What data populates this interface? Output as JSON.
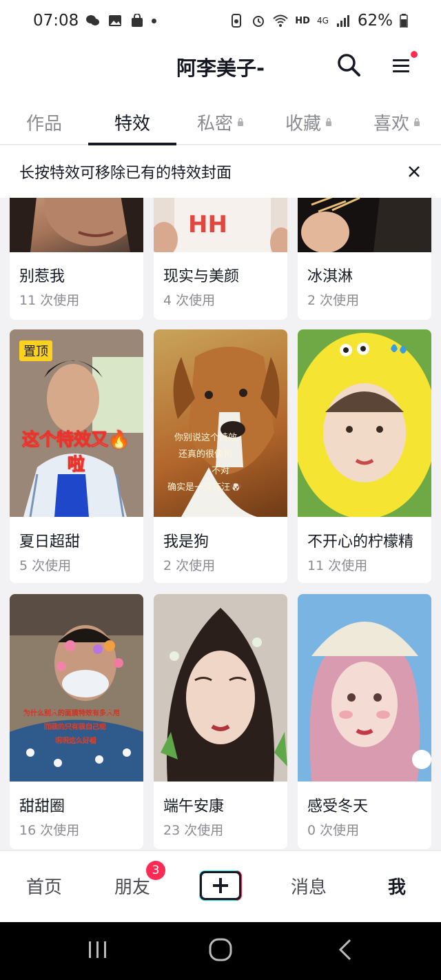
{
  "status_bar": {
    "time": "07:08",
    "battery": "62%",
    "network": "HD",
    "signal_type": "4G"
  },
  "header": {
    "profile_name": "阿李美子-"
  },
  "tabs": [
    {
      "label": "作品",
      "locked": false,
      "active": false
    },
    {
      "label": "特效",
      "locked": false,
      "active": true
    },
    {
      "label": "私密",
      "locked": true,
      "active": false
    },
    {
      "label": "收藏",
      "locked": true,
      "active": false
    },
    {
      "label": "喜欢",
      "locked": true,
      "active": false
    }
  ],
  "notice": {
    "text": "长按特效可移除已有的特效封面"
  },
  "effects": [
    {
      "title": "别惹我",
      "uses": "11 次使用"
    },
    {
      "title": "现实与美颜",
      "uses": "4 次使用"
    },
    {
      "title": "冰淇淋",
      "uses": "2 次使用"
    },
    {
      "title": "夏日超甜",
      "uses": "5 次使用",
      "badge": "置顶",
      "overlay": [
        "这个特效又🔥",
        "啦"
      ]
    },
    {
      "title": "我是狗",
      "uses": "2 次使用",
      "overlay": [
        "你别说这个特效",
        "还真的很像狗",
        "不对",
        "确实是一只汪汪🐶"
      ]
    },
    {
      "title": "不开心的柠檬精",
      "uses": "11 次使用"
    },
    {
      "title": "甜甜圈",
      "uses": "16 次使用",
      "overlay": [
        "为什么别人的面膜特效有多人用",
        "而我的只有我自己呢",
        "明明这么好看"
      ]
    },
    {
      "title": "端午安康",
      "uses": "23 次使用"
    },
    {
      "title": "感受冬天",
      "uses": "0 次使用"
    }
  ],
  "bottom_nav": {
    "home": "首页",
    "friends": "朋友",
    "friends_badge": "3",
    "messages": "消息",
    "me": "我"
  },
  "colors": {
    "accent": "#fe2c55",
    "badge_yellow": "#fcd21e",
    "text_primary": "#161823",
    "text_secondary": "#8a8b91"
  }
}
